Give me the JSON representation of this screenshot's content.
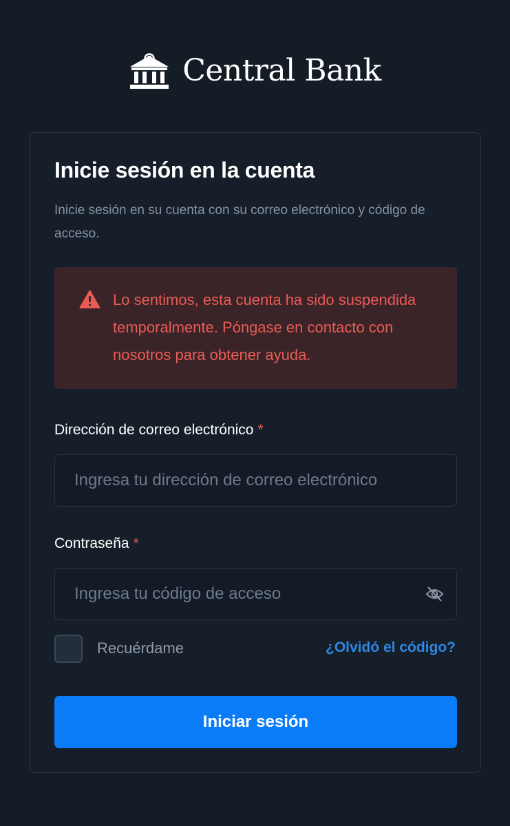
{
  "brand": {
    "name": "Central Bank",
    "logo_icon": "bank-building-icon",
    "logo_color": "#ffffff"
  },
  "card": {
    "title": "Inicie sesión en la cuenta",
    "subtitle": "Inicie sesión en su cuenta con su correo electrónico y código de acceso."
  },
  "alert": {
    "icon": "warning-triangle-icon",
    "message": "Lo sentimos, esta cuenta ha sido suspendida temporalmente. Póngase en contacto con nosotros para obtener ayuda.",
    "text_color": "#ea5b55",
    "background": "#3a2428"
  },
  "email": {
    "label": "Dirección de correo electrónico",
    "required_mark": "*",
    "placeholder": "Ingresa tu dirección de correo electrónico",
    "value": ""
  },
  "password": {
    "label": "Contraseña",
    "required_mark": "*",
    "placeholder": "Ingresa tu código de acceso",
    "value": "",
    "toggle_icon": "eye-slash-icon"
  },
  "remember": {
    "label": "Recuérdame",
    "checked": false
  },
  "forgot": {
    "label": "¿Olvidó el código?",
    "color": "#2f86e3"
  },
  "submit": {
    "label": "Iniciar sesión",
    "color": "#0b7cf7"
  }
}
